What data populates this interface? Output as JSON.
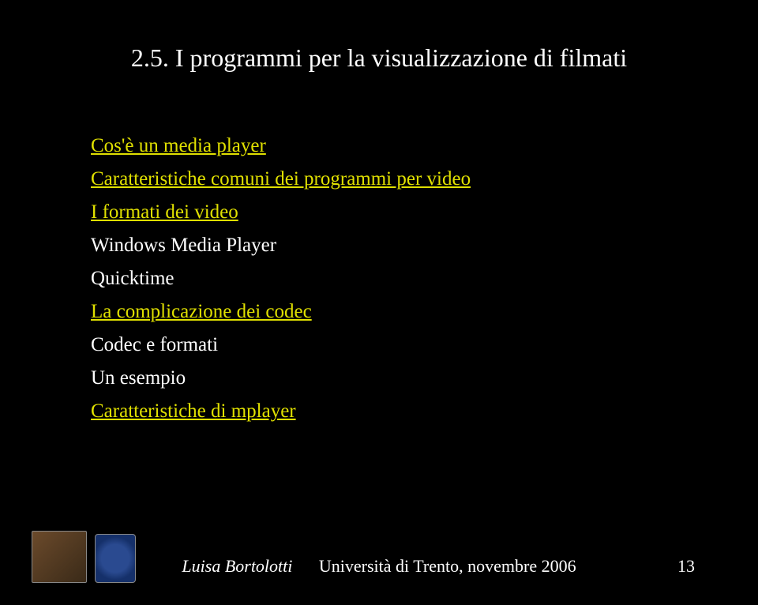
{
  "title": "2.5. I programmi per la visualizzazione di filmati",
  "items": [
    {
      "text": "Cos'è un media player",
      "link": true
    },
    {
      "text": "Caratteristiche comuni dei programmi per video",
      "link": true
    },
    {
      "text": "I formati dei video",
      "link": true
    },
    {
      "text": "Windows Media Player",
      "link": false
    },
    {
      "text": "Quicktime",
      "link": false
    },
    {
      "text": "La complicazione dei codec",
      "link": true
    },
    {
      "text": "Codec e formati",
      "link": false
    },
    {
      "text": "Un esempio",
      "link": false
    },
    {
      "text": "Caratteristiche di mplayer",
      "link": true
    }
  ],
  "footer": {
    "author": "Luisa Bortolotti",
    "affiliation": "Università di Trento,  novembre 2006"
  },
  "page_number": "13",
  "images": {
    "enigma_alt": "Enigma machine",
    "crest_alt": "Università di Trento crest"
  }
}
